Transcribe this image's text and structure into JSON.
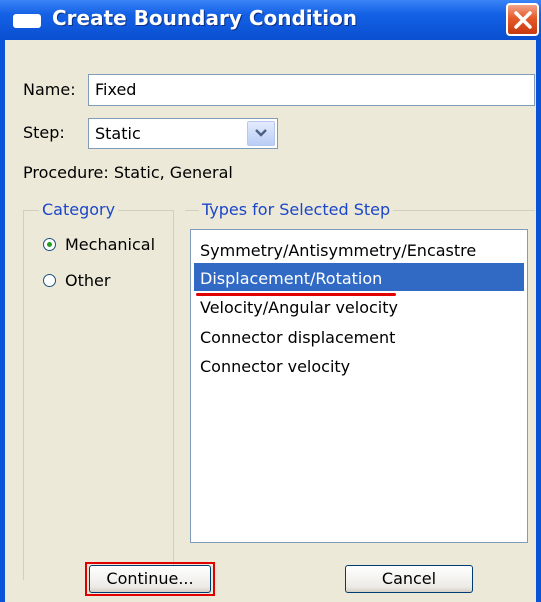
{
  "window": {
    "title": "Create Boundary Condition"
  },
  "form": {
    "name_label": "Name:",
    "name_value": "Fixed",
    "step_label": "Step:",
    "step_value": "Static",
    "procedure_text": "Procedure:  Static, General"
  },
  "category": {
    "title": "Category",
    "options": [
      {
        "label": "Mechanical",
        "selected": true
      },
      {
        "label": "Other",
        "selected": false
      }
    ]
  },
  "types": {
    "title": "Types for Selected Step",
    "items": [
      "Symmetry/Antisymmetry/Encastre",
      "Displacement/Rotation",
      "Velocity/Angular velocity",
      "Connector displacement",
      "Connector velocity"
    ],
    "selected_index": 1
  },
  "buttons": {
    "continue": "Continue...",
    "cancel": "Cancel"
  },
  "colors": {
    "titlebar": "#0a53d6",
    "selection": "#316ac5",
    "annotation": "#e00000",
    "group_title": "#1c46c8"
  }
}
